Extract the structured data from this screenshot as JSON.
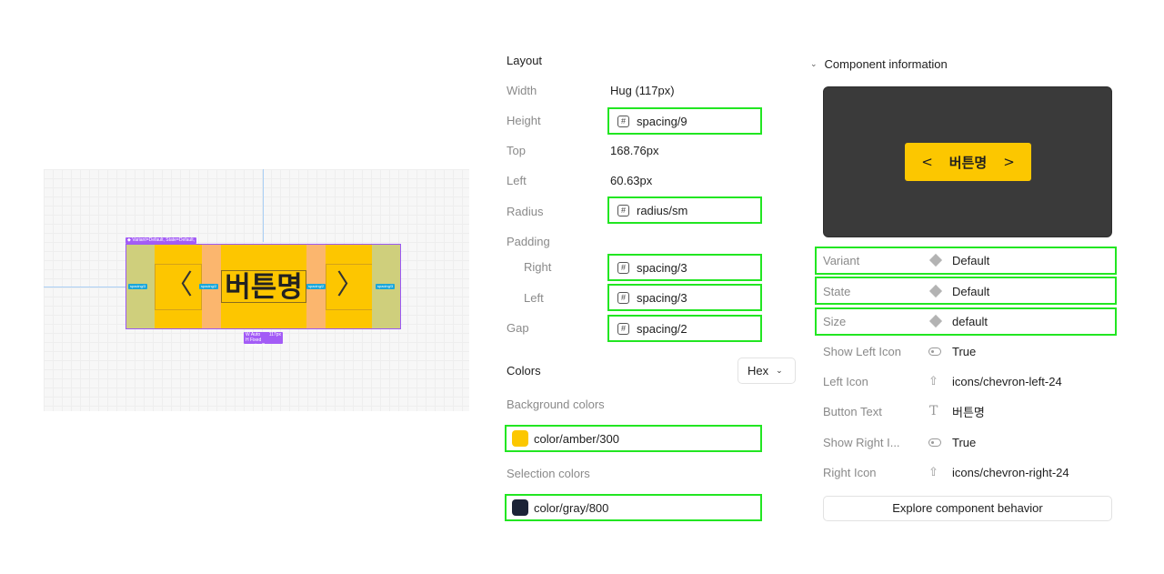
{
  "canvas": {
    "selection_label": "◆ Variant=Default, State=Default, ...",
    "button_label": "버튼명",
    "left_glyph": "〈",
    "right_glyph": "〉",
    "measure_labels": [
      "spacing/3",
      "spacing/2",
      "spacing/2",
      "spacing/3"
    ],
    "size_tag": {
      "w_label": "W Auto",
      "w_value": "117px",
      "h_label": "H Fixed spacing/9"
    }
  },
  "layout": {
    "title": "Layout",
    "width": {
      "label": "Width",
      "value": "Hug (117px)"
    },
    "height": {
      "label": "Height",
      "token": "spacing/9"
    },
    "top": {
      "label": "Top",
      "value": "168.76px"
    },
    "left": {
      "label": "Left",
      "value": "60.63px"
    },
    "radius": {
      "label": "Radius",
      "token": "radius/sm"
    },
    "padding": {
      "label": "Padding"
    },
    "padding_right": {
      "label": "Right",
      "token": "spacing/3"
    },
    "padding_left": {
      "label": "Left",
      "token": "spacing/3"
    },
    "gap": {
      "label": "Gap",
      "token": "spacing/2"
    }
  },
  "colors": {
    "title": "Colors",
    "format": "Hex",
    "background_title": "Background colors",
    "background_token": "color/amber/300",
    "background_hex": "#FCC700",
    "selection_title": "Selection colors",
    "selection_token": "color/gray/800",
    "selection_hex": "#1B2337",
    "highlight": "#22E622"
  },
  "component": {
    "title": "Component information",
    "preview_label": "버튼명",
    "preview_left": "<",
    "preview_right": ">",
    "rows": [
      {
        "label": "Variant",
        "icon": "variant-diamond-icon",
        "value": "Default"
      },
      {
        "label": "State",
        "icon": "variant-diamond-icon",
        "value": "Default"
      },
      {
        "label": "Size",
        "icon": "variant-diamond-icon",
        "value": "default"
      },
      {
        "label": "Show Left Icon",
        "icon": "boolean-toggle-icon",
        "value": "True"
      },
      {
        "label": "Left Icon",
        "icon": "instance-swap-icon",
        "value": "icons/chevron-left-24"
      },
      {
        "label": "Button Text",
        "icon": "text-property-icon",
        "value": "버튼명"
      },
      {
        "label": "Show Right I...",
        "icon": "boolean-toggle-icon",
        "value": "True"
      },
      {
        "label": "Right Icon",
        "icon": "instance-swap-icon",
        "value": "icons/chevron-right-24"
      }
    ],
    "explore_label": "Explore component behavior"
  }
}
